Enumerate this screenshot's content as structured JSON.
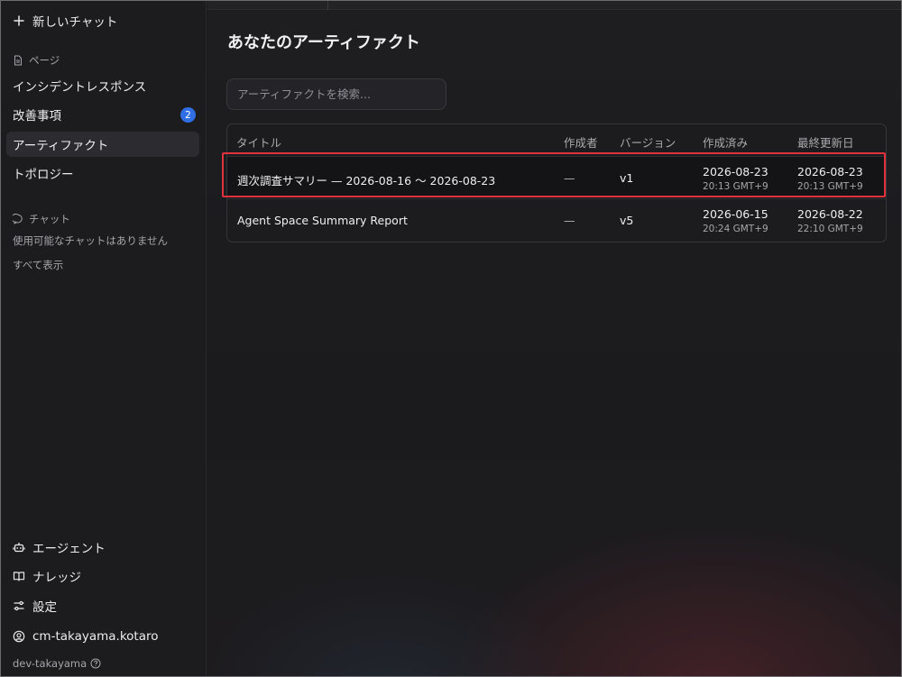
{
  "sidebar": {
    "new_chat": "新しいチャット",
    "pages_section": "ページ",
    "items": [
      {
        "label": "インシデントレスポンス"
      },
      {
        "label": "改善事項",
        "badge": "2"
      },
      {
        "label": "アーティファクト"
      },
      {
        "label": "トポロジー"
      }
    ],
    "chat_section": "チャット",
    "no_chats": "使用可能なチャットはありません",
    "show_all": "すべて表示",
    "bottom": {
      "agent": "エージェント",
      "knowledge": "ナレッジ",
      "settings": "設定",
      "user": "cm-takayama.kotaro",
      "workspace": "dev-takayama"
    }
  },
  "main": {
    "title": "あなたのアーティファクト",
    "search_placeholder": "アーティファクトを検索...",
    "columns": {
      "title": "タイトル",
      "author": "作成者",
      "version": "バージョン",
      "created": "作成済み",
      "updated": "最終更新日"
    },
    "rows": [
      {
        "title": "週次調査サマリー — 2026-08-16 〜 2026-08-23",
        "author": "—",
        "version": "v1",
        "created_date": "2026-08-23",
        "created_time": "20:13 GMT+9",
        "updated_date": "2026-08-23",
        "updated_time": "20:13 GMT+9"
      },
      {
        "title": "Agent Space Summary Report",
        "author": "—",
        "version": "v5",
        "created_date": "2026-06-15",
        "created_time": "20:24 GMT+9",
        "updated_date": "2026-08-22",
        "updated_time": "22:10 GMT+9"
      }
    ]
  },
  "colors": {
    "accent_badge": "#2f6ee5",
    "highlight": "#e0323c"
  }
}
